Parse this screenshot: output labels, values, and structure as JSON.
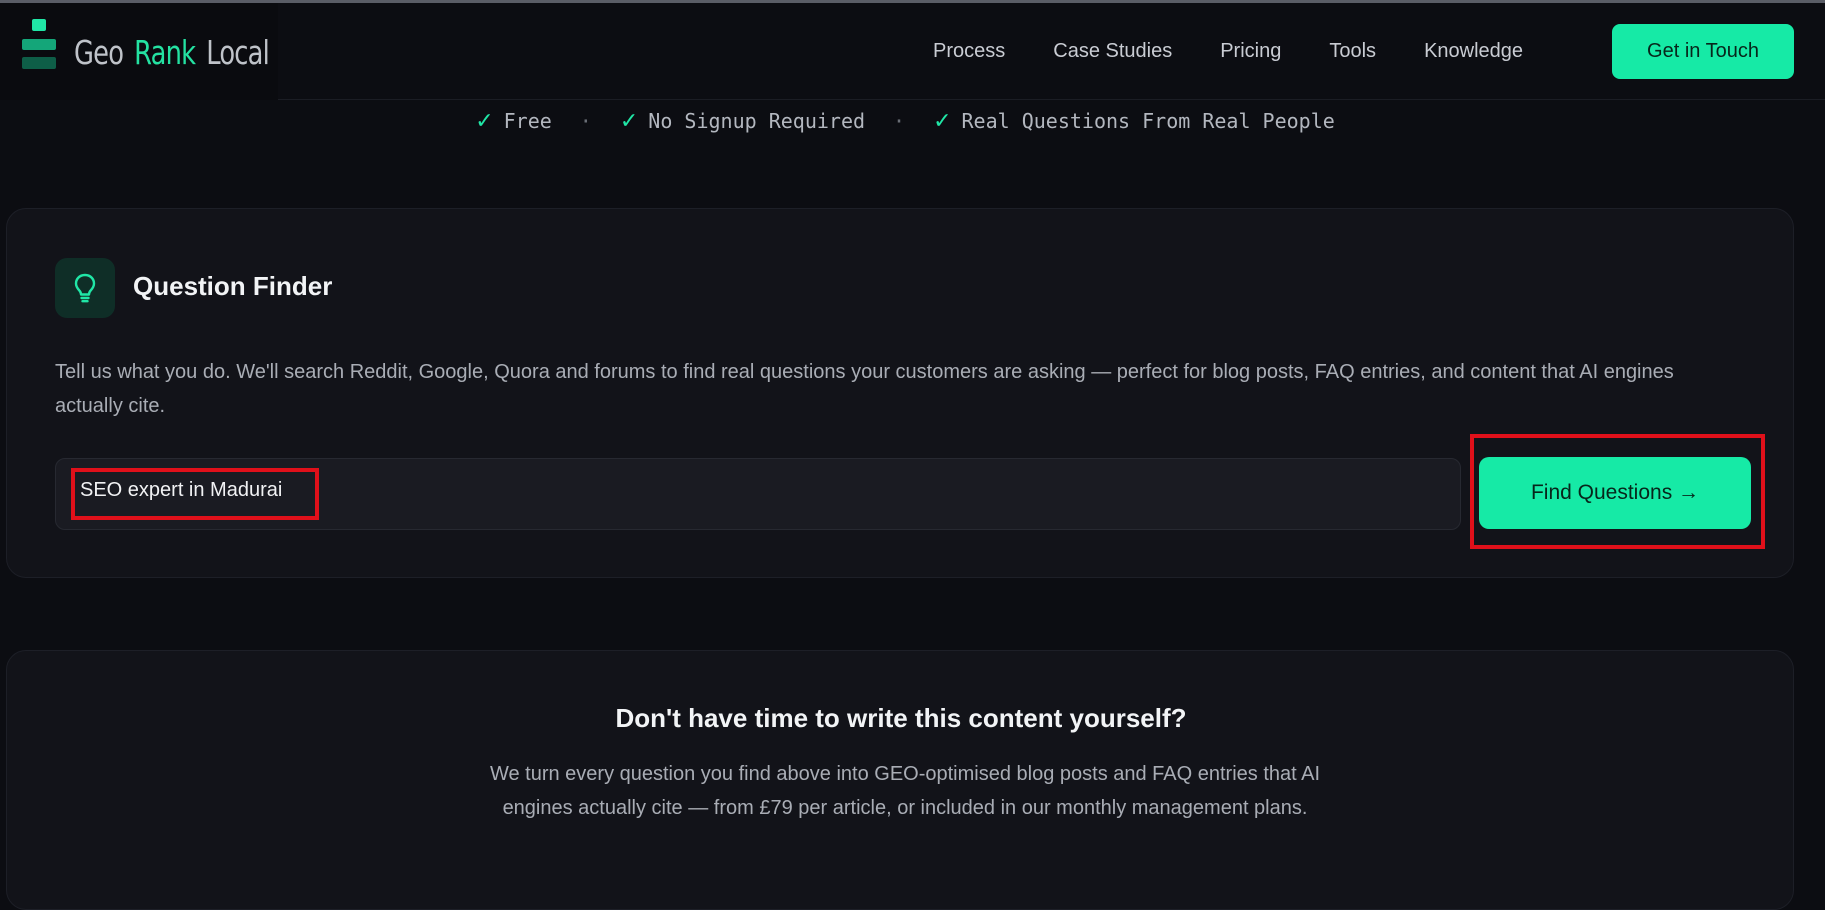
{
  "header": {
    "logo": {
      "word1": "Geo",
      "word2": "Rank",
      "word3": "Local"
    },
    "nav": [
      "Process",
      "Case Studies",
      "Pricing",
      "Tools",
      "Knowledge"
    ],
    "cta_label": "Get in Touch"
  },
  "badges": [
    "Free",
    "No Signup Required",
    "Real Questions From Real People"
  ],
  "badge_separator": "·",
  "finder": {
    "title": "Question Finder",
    "description": "Tell us what you do. We'll search Reddit, Google, Quora and forums to find real questions your customers are asking — perfect for blog posts, FAQ entries, and content that AI engines actually cite.",
    "input_value": "SEO expert in Madurai",
    "button_label": "Find Questions →"
  },
  "promo": {
    "title": "Don't have time to write this content yourself?",
    "text": "We turn every question you find above into GEO-optimised blog posts and FAQ entries that AI engines actually cite — from £79 per article, or included in our monthly management plans."
  },
  "colors": {
    "accent": "#16eaa6",
    "background": "#0c0d12",
    "card": "#121319",
    "highlight": "#e0101a"
  },
  "icons": {
    "logo": "stacked-bars-icon",
    "check": "check-icon",
    "finder": "lightbulb-icon"
  }
}
